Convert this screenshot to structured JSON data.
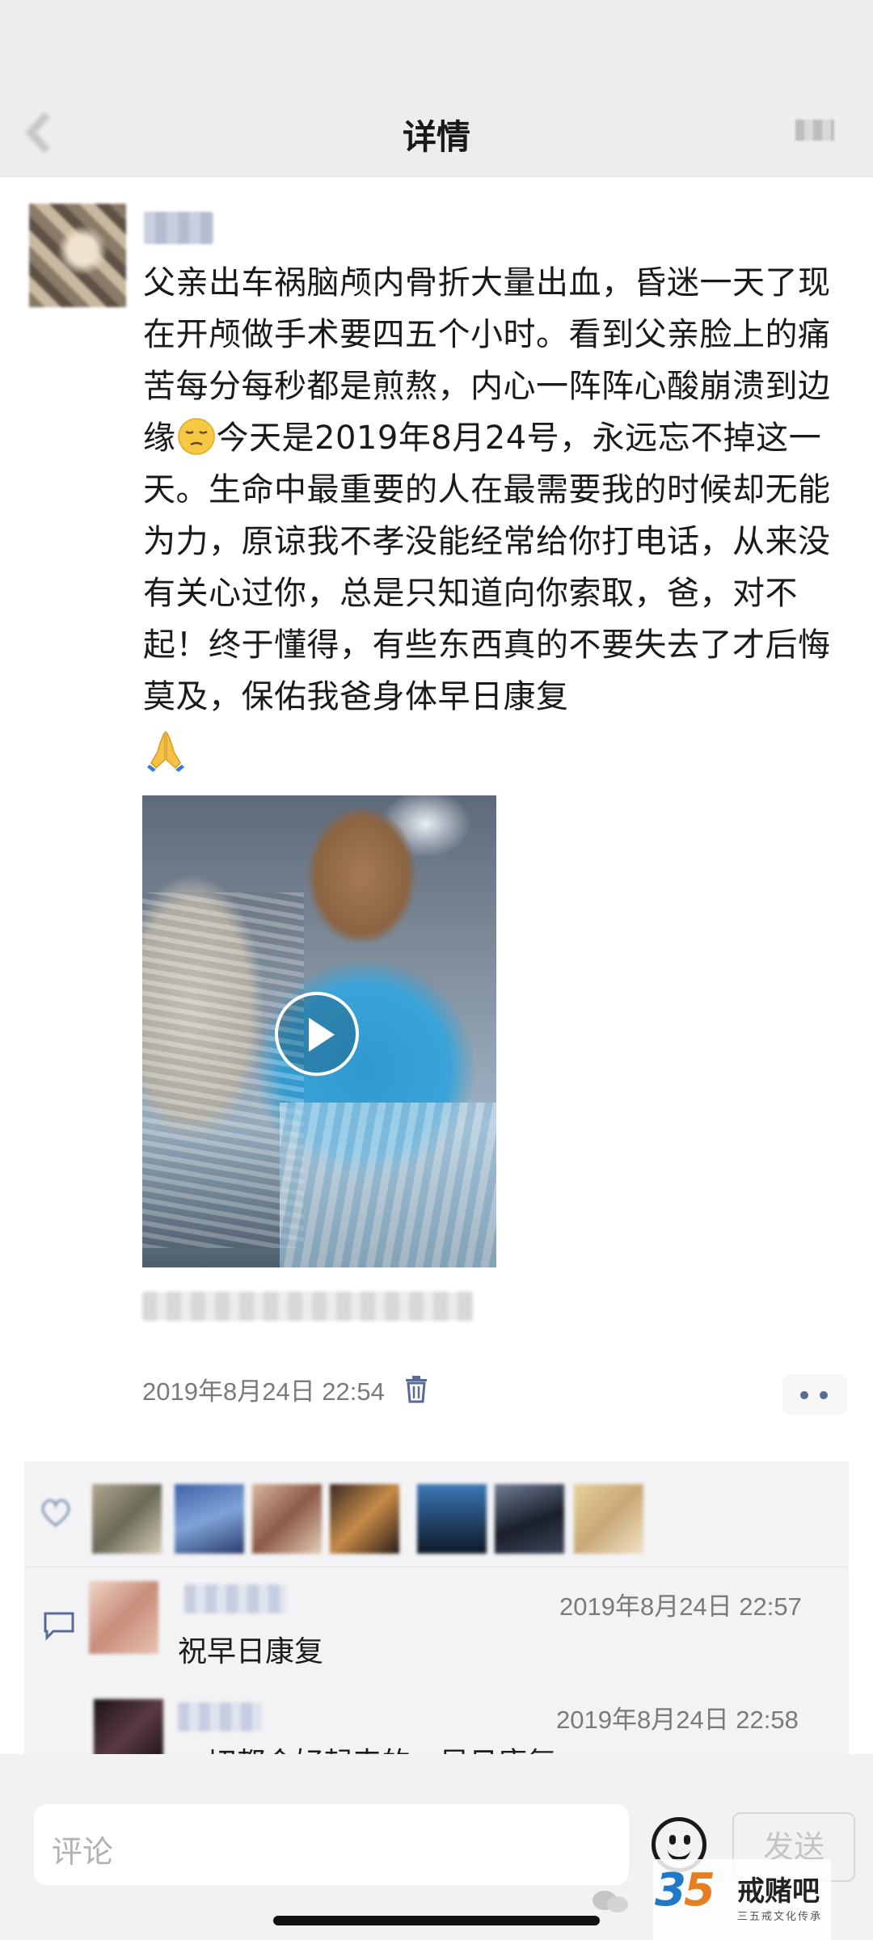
{
  "nav": {
    "title": "详情"
  },
  "post": {
    "text_part1": "父亲出车祸脑颅内骨折大量出血，昏迷一天了现在开颅做手术要四五个小时。看到父亲脸上的痛苦每分每秒都是煎熬，内心一阵阵心酸崩溃到边缘",
    "text_part2": "今天是2019年8月24号，永远忘不掉这一天。生命中最重要的人在最需要我的时候却无能为力，原谅我不孝没能经常给你打电话，从来没有关心过你，总是只知道向你索取，爸，对不起！终于懂得，有些东西真的不要失去了才后悔莫及，保佑我爸身体早日康复",
    "inline_emoji": "pensive-face-icon",
    "trailing_emoji": "folded-hands-icon",
    "timestamp": "2019年8月24日 22:54",
    "has_video": true
  },
  "comments": [
    {
      "time": "2019年8月24日 22:57",
      "text": "祝早日康复"
    },
    {
      "time": "2019年8月24日 22:58",
      "text": "一切都会好起来的，早日康复"
    }
  ],
  "likes": {
    "avatar_count": 7
  },
  "input": {
    "placeholder": "评论",
    "send_label": "发送"
  },
  "watermark": {
    "number_a": "3",
    "number_b": "5",
    "title": "戒赌吧",
    "subtitle": "三五戒文化传承"
  },
  "colors": {
    "nav_background": "#ededed",
    "link_blue": "#576b95",
    "timestamp_gray": "#7a7a7a",
    "panel_background": "#f3f3f5"
  }
}
